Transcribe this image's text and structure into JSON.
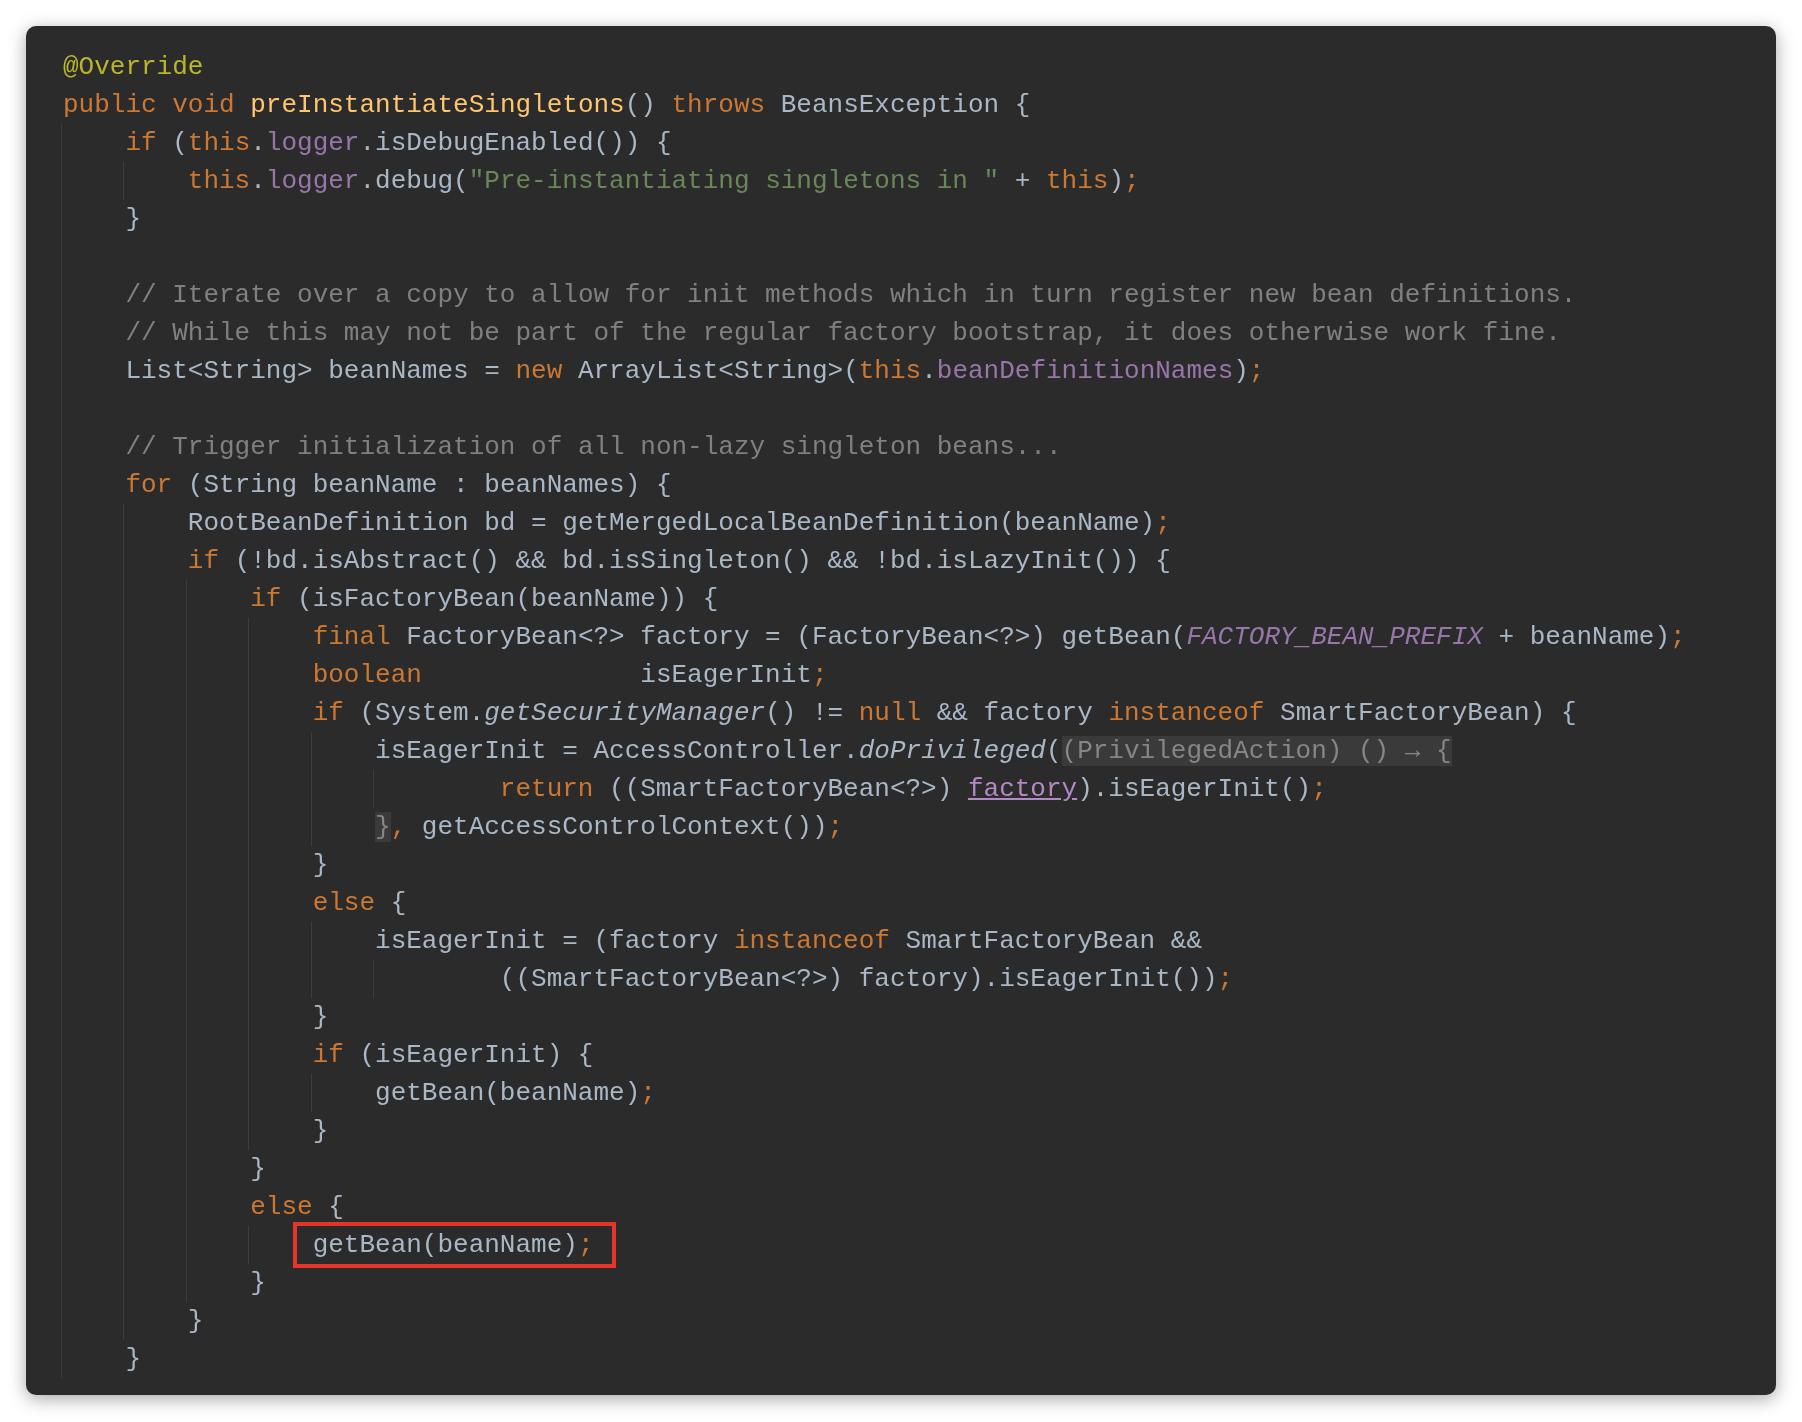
{
  "editor": {
    "lines": [
      {
        "tokens": [
          {
            "text": "@Override",
            "kind": "anno"
          }
        ]
      },
      {
        "tokens": [
          {
            "text": "public ",
            "kind": "kw"
          },
          {
            "text": "void ",
            "kind": "kw"
          },
          {
            "text": "preInstantiateSingletons",
            "kind": "decl"
          },
          {
            "text": "() ",
            "kind": "p"
          },
          {
            "text": "throws ",
            "kind": "kw"
          },
          {
            "text": "BeansException {",
            "kind": "p"
          }
        ],
        "children": [
          {
            "tokens": [
              {
                "text": "if ",
                "kind": "kw"
              },
              {
                "text": "(",
                "kind": "p"
              },
              {
                "text": "this",
                "kind": "kw"
              },
              {
                "text": ".",
                "kind": "p"
              },
              {
                "text": "logger",
                "kind": "field"
              },
              {
                "text": ".isDebugEnabled()) {",
                "kind": "p"
              }
            ],
            "children": [
              {
                "tokens": [
                  {
                    "text": "this",
                    "kind": "kw"
                  },
                  {
                    "text": ".",
                    "kind": "p"
                  },
                  {
                    "text": "logger",
                    "kind": "field"
                  },
                  {
                    "text": ".debug(",
                    "kind": "p"
                  },
                  {
                    "text": "\"Pre-instantiating singletons in \"",
                    "kind": "str"
                  },
                  {
                    "text": " + ",
                    "kind": "p"
                  },
                  {
                    "text": "this",
                    "kind": "kw"
                  },
                  {
                    "text": ")",
                    "kind": "p"
                  },
                  {
                    "text": ";",
                    "kind": "kw"
                  }
                ]
              }
            ]
          },
          {
            "tokens": [
              {
                "text": "}",
                "kind": "p"
              }
            ]
          },
          {
            "blank_line_before": true,
            "tokens": [
              {
                "text": "// Iterate over a copy to allow for init methods which in turn register new bean definitions.",
                "kind": "comment"
              }
            ]
          },
          {
            "tokens": [
              {
                "text": "// While this may not be part of the regular factory bootstrap, it does otherwise work fine.",
                "kind": "comment"
              }
            ]
          },
          {
            "tokens": [
              {
                "text": "List<String> beanNames = ",
                "kind": "p"
              },
              {
                "text": "new ",
                "kind": "kw"
              },
              {
                "text": "ArrayList<String>(",
                "kind": "p"
              },
              {
                "text": "this",
                "kind": "kw"
              },
              {
                "text": ".",
                "kind": "p"
              },
              {
                "text": "beanDefinitionNames",
                "kind": "field"
              },
              {
                "text": ")",
                "kind": "p"
              },
              {
                "text": ";",
                "kind": "kw"
              }
            ]
          },
          {
            "blank_line_before": true,
            "tokens": [
              {
                "text": "// Trigger initialization of all non-lazy singleton beans...",
                "kind": "comment"
              }
            ]
          },
          {
            "tokens": [
              {
                "text": "for ",
                "kind": "kw"
              },
              {
                "text": "(String beanName : beanNames) {",
                "kind": "p"
              }
            ],
            "children": [
              {
                "tokens": [
                  {
                    "text": "RootBeanDefinition bd = getMergedLocalBeanDefinition(beanName)",
                    "kind": "p"
                  },
                  {
                    "text": ";",
                    "kind": "kw"
                  }
                ]
              },
              {
                "tokens": [
                  {
                    "text": "if ",
                    "kind": "kw"
                  },
                  {
                    "text": "(!bd.isAbstract() && bd.isSingleton() && !bd.isLazyInit()) {",
                    "kind": "p"
                  }
                ],
                "children": [
                  {
                    "tokens": [
                      {
                        "text": "if ",
                        "kind": "kw"
                      },
                      {
                        "text": "(isFactoryBean(beanName)) {",
                        "kind": "p"
                      }
                    ],
                    "children": [
                      {
                        "tokens": [
                          {
                            "text": "final ",
                            "kind": "kw"
                          },
                          {
                            "text": "FactoryBean<?> factory = (FactoryBean<?>) getBean(",
                            "kind": "p"
                          },
                          {
                            "text": "FACTORY_BEAN_PREFIX",
                            "kind": "const"
                          },
                          {
                            "text": " + beanName)",
                            "kind": "p"
                          },
                          {
                            "text": ";",
                            "kind": "kw"
                          }
                        ]
                      },
                      {
                        "tokens": [
                          {
                            "text": "boolean",
                            "kind": "kw"
                          },
                          {
                            "text": "              isEagerInit",
                            "kind": "p"
                          },
                          {
                            "text": ";",
                            "kind": "kw"
                          }
                        ]
                      },
                      {
                        "tokens": [
                          {
                            "text": "if ",
                            "kind": "kw"
                          },
                          {
                            "text": "(System.",
                            "kind": "p"
                          },
                          {
                            "text": "getSecurityManager",
                            "kind": "italic"
                          },
                          {
                            "text": "() != ",
                            "kind": "p"
                          },
                          {
                            "text": "null ",
                            "kind": "kw"
                          },
                          {
                            "text": "&& factory ",
                            "kind": "p"
                          },
                          {
                            "text": "instanceof ",
                            "kind": "kw"
                          },
                          {
                            "text": "SmartFactoryBean) {",
                            "kind": "p"
                          }
                        ],
                        "children": [
                          {
                            "tokens": [
                              {
                                "text": "isEagerInit = AccessController.",
                                "kind": "p"
                              },
                              {
                                "text": "doPrivileged",
                                "kind": "italic"
                              },
                              {
                                "text": "(",
                                "kind": "p"
                              },
                              {
                                "text": "(PrivilegedAction) () → {",
                                "kind": "fold"
                              }
                            ],
                            "continuation": [
                              {
                                "tokens": [
                                  {
                                    "text": "return ",
                                    "kind": "kw"
                                  },
                                  {
                                    "text": "((SmartFactoryBean<?>) ",
                                    "kind": "p"
                                  },
                                  {
                                    "text": "factory",
                                    "kind": "link"
                                  },
                                  {
                                    "text": ").isEagerInit()",
                                    "kind": "p"
                                  },
                                  {
                                    "text": ";",
                                    "kind": "kw"
                                  }
                                ]
                              }
                            ]
                          },
                          {
                            "tokens": [
                              {
                                "text": "}",
                                "kind": "fold"
                              },
                              {
                                "text": ", ",
                                "kind": "kw"
                              },
                              {
                                "text": "getAccessControlContext())",
                                "kind": "p"
                              },
                              {
                                "text": ";",
                                "kind": "kw"
                              }
                            ]
                          }
                        ]
                      },
                      {
                        "tokens": [
                          {
                            "text": "}",
                            "kind": "p"
                          }
                        ]
                      },
                      {
                        "tokens": [
                          {
                            "text": "else ",
                            "kind": "kw"
                          },
                          {
                            "text": "{",
                            "kind": "p"
                          }
                        ],
                        "children": [
                          {
                            "tokens": [
                              {
                                "text": "isEagerInit = (factory ",
                                "kind": "p"
                              },
                              {
                                "text": "instanceof ",
                                "kind": "kw"
                              },
                              {
                                "text": "SmartFactoryBean &&",
                                "kind": "p"
                              }
                            ],
                            "continuation": [
                              {
                                "tokens": [
                                  {
                                    "text": "((SmartFactoryBean<?>) factory).isEagerInit())",
                                    "kind": "p"
                                  },
                                  {
                                    "text": ";",
                                    "kind": "kw"
                                  }
                                ]
                              }
                            ]
                          }
                        ]
                      },
                      {
                        "tokens": [
                          {
                            "text": "}",
                            "kind": "p"
                          }
                        ]
                      },
                      {
                        "tokens": [
                          {
                            "text": "if ",
                            "kind": "kw"
                          },
                          {
                            "text": "(isEagerInit) {",
                            "kind": "p"
                          }
                        ],
                        "children": [
                          {
                            "tokens": [
                              {
                                "text": "getBean(beanName)",
                                "kind": "p"
                              },
                              {
                                "text": ";",
                                "kind": "kw"
                              }
                            ]
                          }
                        ]
                      },
                      {
                        "tokens": [
                          {
                            "text": "}",
                            "kind": "p"
                          }
                        ]
                      }
                    ]
                  },
                  {
                    "tokens": [
                      {
                        "text": "}",
                        "kind": "p"
                      }
                    ]
                  },
                  {
                    "tokens": [
                      {
                        "text": "else ",
                        "kind": "kw"
                      },
                      {
                        "text": "{",
                        "kind": "p"
                      }
                    ],
                    "children": [
                      {
                        "boxed": true,
                        "tokens": [
                          {
                            "text": "getBean(beanName)",
                            "kind": "p"
                          },
                          {
                            "text": ";",
                            "kind": "kw"
                          }
                        ]
                      }
                    ]
                  },
                  {
                    "tokens": [
                      {
                        "text": "}",
                        "kind": "p"
                      }
                    ]
                  }
                ]
              },
              {
                "tokens": [
                  {
                    "text": "}",
                    "kind": "p"
                  }
                ]
              }
            ]
          },
          {
            "tokens": [
              {
                "text": "}",
                "kind": "p"
              }
            ]
          }
        ]
      }
    ]
  }
}
